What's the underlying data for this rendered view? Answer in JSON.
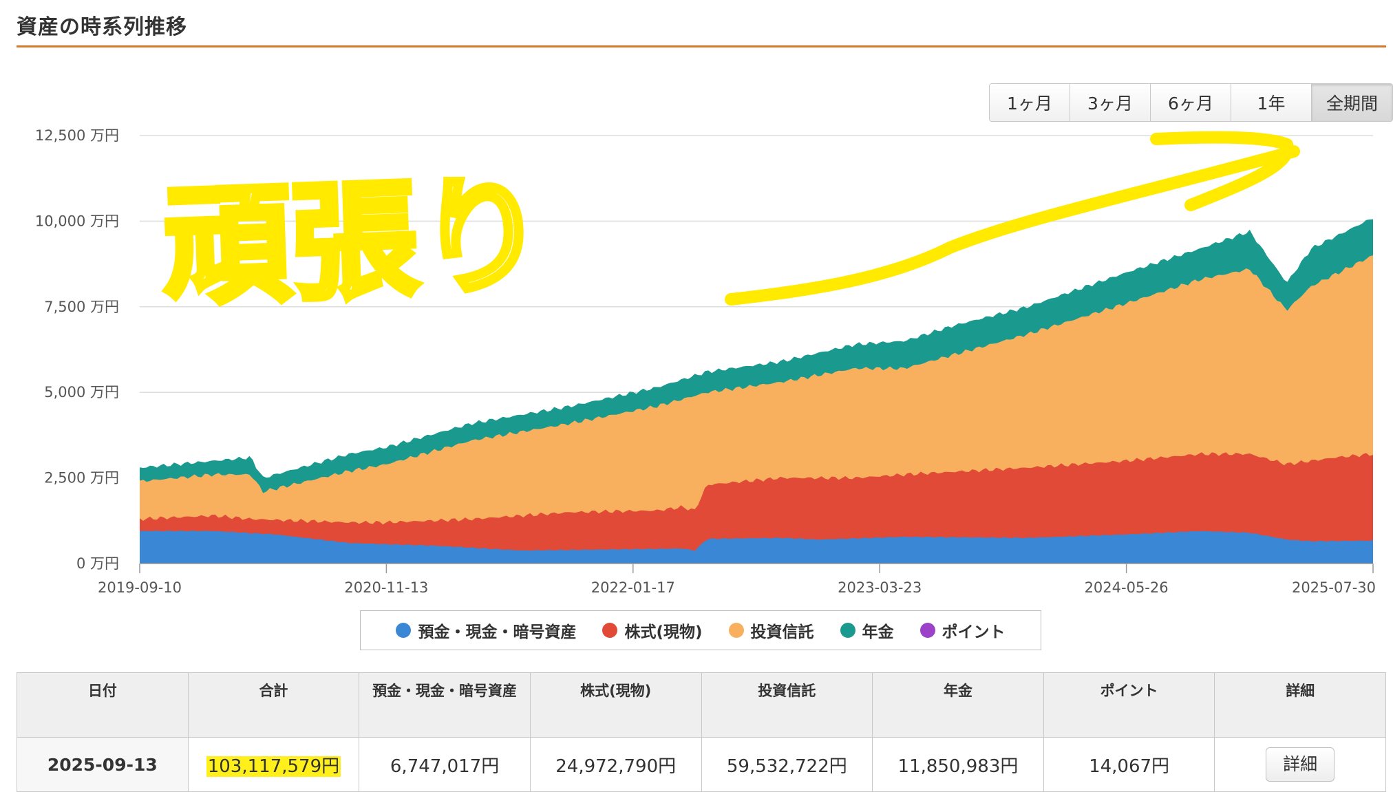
{
  "header": {
    "title": "資産の時系列推移"
  },
  "range_buttons": [
    {
      "label": "1ヶ月"
    },
    {
      "label": "3ヶ月"
    },
    {
      "label": "6ヶ月"
    },
    {
      "label": "1年"
    },
    {
      "label": "全期間"
    }
  ],
  "range_active": "全期間",
  "annotation": {
    "text": "頑張り",
    "arrow": "yellow-arrow-up-right",
    "color": "#ffea00"
  },
  "chart_data": {
    "type": "area",
    "stacked": true,
    "x": [
      "2019-09-10",
      "2020-11-13",
      "2022-01-17",
      "2023-03-23",
      "2024-05-26",
      "2025-07-30"
    ],
    "x_tick_labels": [
      "2019-09-10",
      "2020-11-13",
      "2022-01-17",
      "2023-03-23",
      "2024-05-26",
      "2025-07-30"
    ],
    "y_tick_labels": [
      "0 万円",
      "2,500 万円",
      "5,000 万円",
      "7,500 万円",
      "10,000 万円",
      "12,500 万円"
    ],
    "ylim": [
      0,
      12500
    ],
    "y_unit": "万円",
    "grid": true,
    "series": [
      {
        "name": "預金・現金・暗号資産",
        "color": "#3a87d6",
        "values": [
          [
            0,
            950
          ],
          [
            0.06,
            950
          ],
          [
            0.11,
            850
          ],
          [
            0.17,
            600
          ],
          [
            0.24,
            520
          ],
          [
            0.31,
            380
          ],
          [
            0.4,
            420
          ],
          [
            0.44,
            440
          ],
          [
            0.45,
            380
          ],
          [
            0.46,
            720
          ],
          [
            0.52,
            750
          ],
          [
            0.55,
            700
          ],
          [
            0.62,
            780
          ],
          [
            0.72,
            750
          ],
          [
            0.8,
            850
          ],
          [
            0.86,
            950
          ],
          [
            0.9,
            900
          ],
          [
            0.93,
            700
          ],
          [
            0.95,
            650
          ],
          [
            1.0,
            670
          ]
        ]
      },
      {
        "name": "株式(現物)",
        "color": "#e04a37",
        "values": [
          [
            0,
            1300
          ],
          [
            0.06,
            1400
          ],
          [
            0.09,
            1300
          ],
          [
            0.17,
            1200
          ],
          [
            0.2,
            1200
          ],
          [
            0.27,
            1300
          ],
          [
            0.35,
            1500
          ],
          [
            0.42,
            1550
          ],
          [
            0.44,
            1650
          ],
          [
            0.45,
            1550
          ],
          [
            0.46,
            2300
          ],
          [
            0.52,
            2500
          ],
          [
            0.58,
            2500
          ],
          [
            0.62,
            2600
          ],
          [
            0.72,
            2800
          ],
          [
            0.8,
            3000
          ],
          [
            0.86,
            3200
          ],
          [
            0.9,
            3200
          ],
          [
            0.93,
            2900
          ],
          [
            0.97,
            3100
          ],
          [
            1.0,
            3200
          ]
        ]
      },
      {
        "name": "投資信託",
        "color": "#f8b05e",
        "values": [
          [
            0,
            2400
          ],
          [
            0.06,
            2600
          ],
          [
            0.09,
            2600
          ],
          [
            0.1,
            2100
          ],
          [
            0.17,
            2700
          ],
          [
            0.2,
            2900
          ],
          [
            0.27,
            3600
          ],
          [
            0.35,
            4100
          ],
          [
            0.42,
            4600
          ],
          [
            0.46,
            5000
          ],
          [
            0.52,
            5300
          ],
          [
            0.58,
            5700
          ],
          [
            0.62,
            5700
          ],
          [
            0.66,
            6100
          ],
          [
            0.72,
            6700
          ],
          [
            0.8,
            7600
          ],
          [
            0.86,
            8300
          ],
          [
            0.9,
            8600
          ],
          [
            0.93,
            7400
          ],
          [
            0.95,
            8100
          ],
          [
            1.0,
            9000
          ]
        ]
      },
      {
        "name": "年金",
        "color": "#1a9a8e",
        "values": [
          [
            0,
            2800
          ],
          [
            0.06,
            3000
          ],
          [
            0.09,
            3100
          ],
          [
            0.1,
            2500
          ],
          [
            0.17,
            3200
          ],
          [
            0.2,
            3400
          ],
          [
            0.27,
            4100
          ],
          [
            0.35,
            4600
          ],
          [
            0.42,
            5150
          ],
          [
            0.46,
            5600
          ],
          [
            0.52,
            5900
          ],
          [
            0.58,
            6400
          ],
          [
            0.62,
            6500
          ],
          [
            0.66,
            6950
          ],
          [
            0.72,
            7500
          ],
          [
            0.8,
            8500
          ],
          [
            0.86,
            9200
          ],
          [
            0.9,
            9700
          ],
          [
            0.93,
            8200
          ],
          [
            0.95,
            9200
          ],
          [
            1.0,
            10100
          ]
        ]
      },
      {
        "name": "ポイント",
        "color": "#9b42c8",
        "values": [
          [
            0,
            2810
          ],
          [
            1.0,
            10110
          ]
        ]
      }
    ],
    "legend_position": "bottom"
  },
  "legend": [
    {
      "name": "預金・現金・暗号資産",
      "color": "#3a87d6"
    },
    {
      "name": "株式(現物)",
      "color": "#e04a37"
    },
    {
      "name": "投資信託",
      "color": "#f8b05e"
    },
    {
      "name": "年金",
      "color": "#1a9a8e"
    },
    {
      "name": "ポイント",
      "color": "#9b42c8"
    }
  ],
  "table": {
    "headers": [
      "日付",
      "合計",
      "預金・現金・暗号資産",
      "株式(現物)",
      "投資信託",
      "年金",
      "ポイント",
      "詳細"
    ],
    "row": {
      "date": "2025-09-13",
      "total": "103,117,579円",
      "cash": "6,747,017円",
      "stocks": "24,972,790円",
      "funds": "59,532,722円",
      "pension": "11,850,983円",
      "points": "14,067円",
      "detail_label": "詳細"
    }
  }
}
